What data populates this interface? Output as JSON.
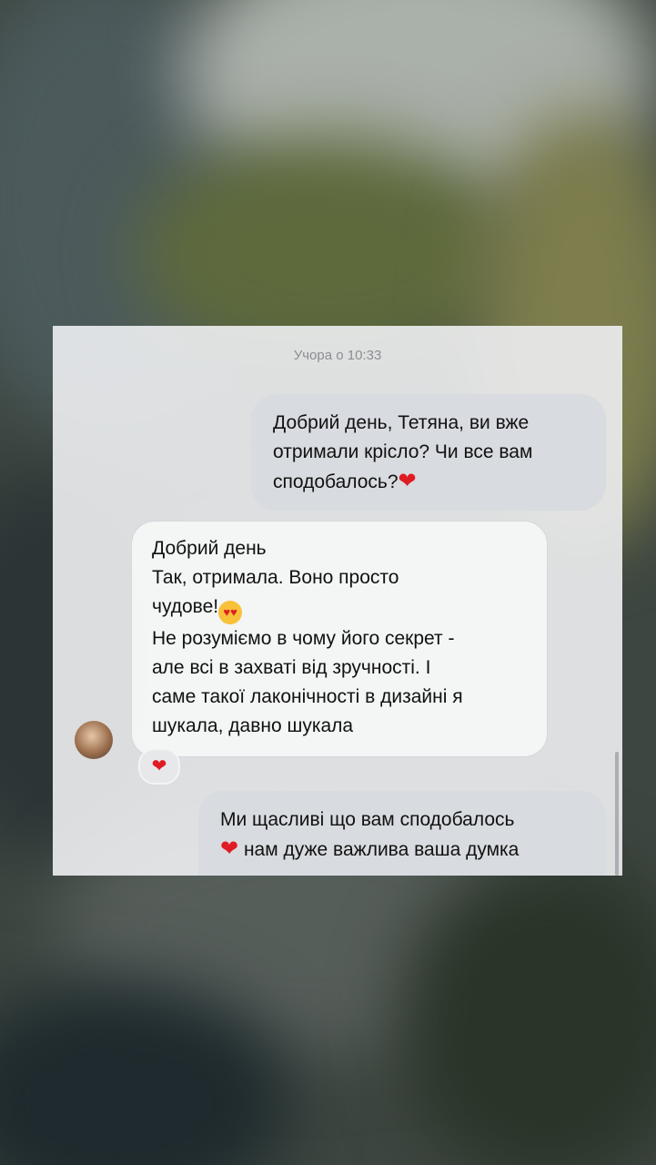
{
  "chat": {
    "timestamp": "Учора о 10:33",
    "messages": [
      {
        "direction": "outgoing",
        "lines": [
          "Добрий день, Тетяна, ви вже",
          "отримали крісло? Чи все вам",
          "сподобалось?"
        ],
        "emoji": "❤"
      },
      {
        "direction": "incoming",
        "lines": [
          "Добрий день",
          "Так, отримала. Воно просто",
          "чудове!",
          "Не розуміємо в чому його секрет -",
          "але всі в захваті від зручності. І",
          "саме такої лаконічності в дизайні я",
          "шукала, давно шукала"
        ],
        "emoji": "😍",
        "reaction": "❤"
      },
      {
        "direction": "outgoing",
        "lines": [
          "Ми щасливі що вам сподобалось",
          "нам дуже важлива ваша думка"
        ],
        "emoji": "❤"
      }
    ]
  },
  "icons": {
    "avatar": "avatar-photo",
    "heart": "red-heart-icon",
    "heart_eyes": "heart-eyes-emoji-icon"
  }
}
